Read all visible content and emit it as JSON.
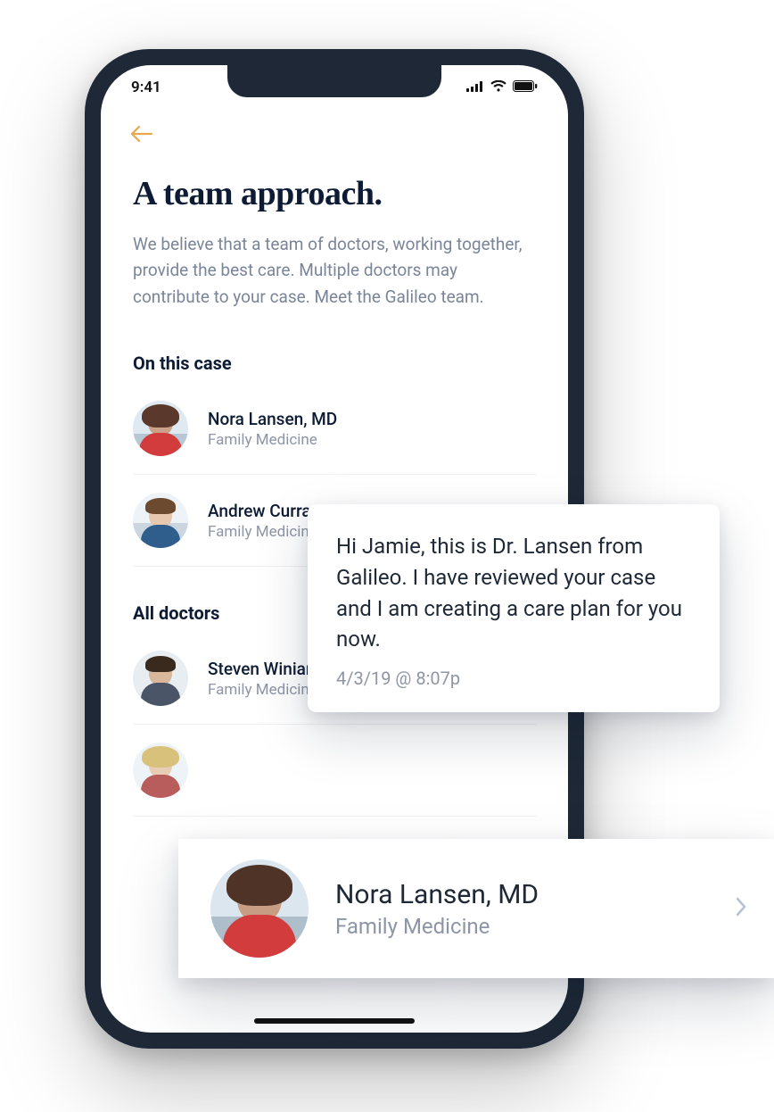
{
  "status": {
    "time": "9:41"
  },
  "page": {
    "title": "A team approach.",
    "intro": "We believe that a team of doctors, working together, provide the best care. Multiple doctors may contribute to your case. Meet the Galileo team."
  },
  "sections": {
    "caseHeading": "On this case",
    "allHeading": "All doctors"
  },
  "caseDoctors": [
    {
      "name": "Nora Lansen, MD",
      "specialty": "Family Medicine"
    },
    {
      "name": "Andrew Curran, MD",
      "specialty": "Family Medicine"
    }
  ],
  "allDoctors": [
    {
      "name": "Steven Winiarski, DO",
      "specialty": "Family Medicine"
    },
    {
      "name": "",
      "specialty": ""
    }
  ],
  "message": {
    "text": "Hi Jamie, this is Dr. Lansen from Galileo. I have reviewed your case and I am creating a care plan for you now.",
    "timestamp": "4/3/19 @ 8:07p"
  },
  "profileCard": {
    "name": "Nora Lansen, MD",
    "specialty": "Family Medicine"
  }
}
